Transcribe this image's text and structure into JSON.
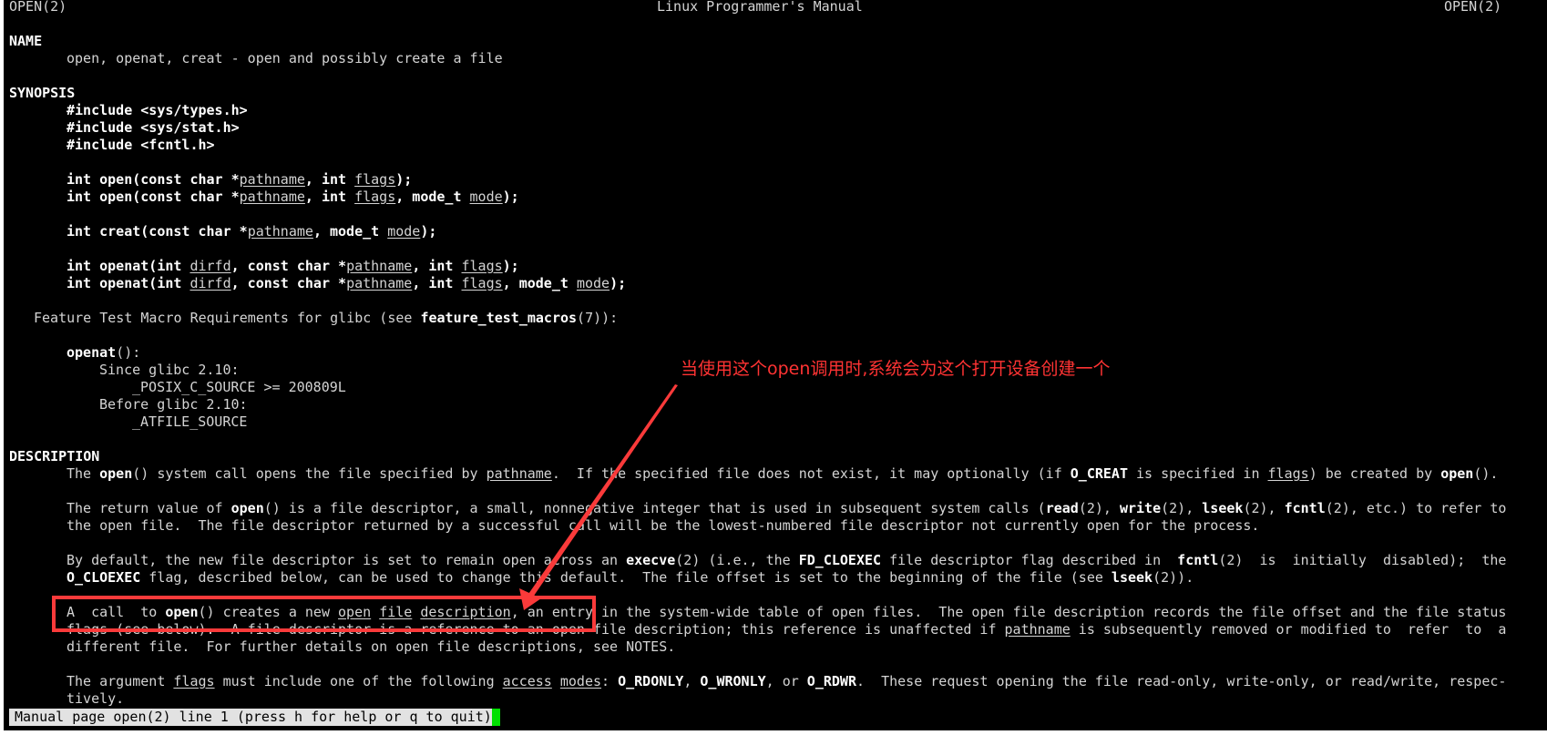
{
  "header": {
    "left": "OPEN(2)",
    "center": "Linux Programmer's Manual",
    "right": "OPEN(2)"
  },
  "lines": [
    {
      "row": 2,
      "col": 0,
      "seg": [
        [
          "b",
          "NAME"
        ]
      ]
    },
    {
      "row": 3,
      "col": 7,
      "seg": [
        [
          "n",
          "open, openat, creat - open and possibly create a file"
        ]
      ]
    },
    {
      "row": 5,
      "col": 0,
      "seg": [
        [
          "b",
          "SYNOPSIS"
        ]
      ]
    },
    {
      "row": 6,
      "col": 7,
      "seg": [
        [
          "b",
          "#include <sys/types.h>"
        ]
      ]
    },
    {
      "row": 7,
      "col": 7,
      "seg": [
        [
          "b",
          "#include <sys/stat.h>"
        ]
      ]
    },
    {
      "row": 8,
      "col": 7,
      "seg": [
        [
          "b",
          "#include <fcntl.h>"
        ]
      ]
    },
    {
      "row": 10,
      "col": 7,
      "seg": [
        [
          "b",
          "int open(const char *"
        ],
        [
          "u",
          "pathname"
        ],
        [
          "b",
          ", int "
        ],
        [
          "u",
          "flags"
        ],
        [
          "b",
          ");"
        ]
      ]
    },
    {
      "row": 11,
      "col": 7,
      "seg": [
        [
          "b",
          "int open(const char *"
        ],
        [
          "u",
          "pathname"
        ],
        [
          "b",
          ", int "
        ],
        [
          "u",
          "flags"
        ],
        [
          "b",
          ", mode_t "
        ],
        [
          "u",
          "mode"
        ],
        [
          "b",
          ");"
        ]
      ]
    },
    {
      "row": 13,
      "col": 7,
      "seg": [
        [
          "b",
          "int creat(const char *"
        ],
        [
          "u",
          "pathname"
        ],
        [
          "b",
          ", mode_t "
        ],
        [
          "u",
          "mode"
        ],
        [
          "b",
          ");"
        ]
      ]
    },
    {
      "row": 15,
      "col": 7,
      "seg": [
        [
          "b",
          "int openat(int "
        ],
        [
          "u",
          "dirfd"
        ],
        [
          "b",
          ", const char *"
        ],
        [
          "u",
          "pathname"
        ],
        [
          "b",
          ", int "
        ],
        [
          "u",
          "flags"
        ],
        [
          "b",
          ");"
        ]
      ]
    },
    {
      "row": 16,
      "col": 7,
      "seg": [
        [
          "b",
          "int openat(int "
        ],
        [
          "u",
          "dirfd"
        ],
        [
          "b",
          ", const char *"
        ],
        [
          "u",
          "pathname"
        ],
        [
          "b",
          ", int "
        ],
        [
          "u",
          "flags"
        ],
        [
          "b",
          ", mode_t "
        ],
        [
          "u",
          "mode"
        ],
        [
          "b",
          ");"
        ]
      ]
    },
    {
      "row": 18,
      "col": 3,
      "seg": [
        [
          "n",
          "Feature Test Macro Requirements for glibc (see "
        ],
        [
          "b",
          "feature_test_macros"
        ],
        [
          "n",
          "(7)):"
        ]
      ]
    },
    {
      "row": 20,
      "col": 7,
      "seg": [
        [
          "b",
          "openat"
        ],
        [
          "n",
          "():"
        ]
      ]
    },
    {
      "row": 21,
      "col": 11,
      "seg": [
        [
          "n",
          "Since glibc 2.10:"
        ]
      ]
    },
    {
      "row": 22,
      "col": 15,
      "seg": [
        [
          "n",
          "_POSIX_C_SOURCE >= 200809L"
        ]
      ]
    },
    {
      "row": 23,
      "col": 11,
      "seg": [
        [
          "n",
          "Before glibc 2.10:"
        ]
      ]
    },
    {
      "row": 24,
      "col": 15,
      "seg": [
        [
          "n",
          "_ATFILE_SOURCE"
        ]
      ]
    },
    {
      "row": 26,
      "col": 0,
      "seg": [
        [
          "b",
          "DESCRIPTION"
        ]
      ]
    },
    {
      "row": 27,
      "col": 7,
      "seg": [
        [
          "n",
          "The "
        ],
        [
          "b",
          "open"
        ],
        [
          "n",
          "() system call opens the file specified by "
        ],
        [
          "u",
          "pathname"
        ],
        [
          "n",
          ".  If the specified file does not exist, it may optionally (if "
        ],
        [
          "b",
          "O_CREAT"
        ],
        [
          "n",
          " is specified in "
        ],
        [
          "u",
          "flags"
        ],
        [
          "n",
          ") be created by "
        ],
        [
          "b",
          "open"
        ],
        [
          "n",
          "()."
        ]
      ]
    },
    {
      "row": 29,
      "col": 7,
      "seg": [
        [
          "n",
          "The return value of "
        ],
        [
          "b",
          "open"
        ],
        [
          "n",
          "() is a file descriptor, a small, nonnegative integer that is used in subsequent system calls ("
        ],
        [
          "b",
          "read"
        ],
        [
          "n",
          "(2), "
        ],
        [
          "b",
          "write"
        ],
        [
          "n",
          "(2), "
        ],
        [
          "b",
          "lseek"
        ],
        [
          "n",
          "(2), "
        ],
        [
          "b",
          "fcntl"
        ],
        [
          "n",
          "(2), etc.) to refer to"
        ]
      ]
    },
    {
      "row": 30,
      "col": 7,
      "seg": [
        [
          "n",
          "the open file.  The file descriptor returned by a successful call will be the lowest-numbered file descriptor not currently open for the process."
        ]
      ]
    },
    {
      "row": 32,
      "col": 7,
      "seg": [
        [
          "n",
          "By default, the new file descriptor is set to remain open across an "
        ],
        [
          "b",
          "execve"
        ],
        [
          "n",
          "(2) (i.e., the "
        ],
        [
          "b",
          "FD_CLOEXEC"
        ],
        [
          "n",
          " file descriptor flag described in  "
        ],
        [
          "b",
          "fcntl"
        ],
        [
          "n",
          "(2)  is  initially  disabled);  the"
        ]
      ]
    },
    {
      "row": 33,
      "col": 7,
      "seg": [
        [
          "b",
          "O_CLOEXEC"
        ],
        [
          "n",
          " flag, described below, can be used to change this default.  The file offset is set to the beginning of the file (see "
        ],
        [
          "b",
          "lseek"
        ],
        [
          "n",
          "(2))."
        ]
      ]
    },
    {
      "row": 35,
      "col": 7,
      "seg": [
        [
          "n",
          "A  call  to "
        ],
        [
          "b",
          "open"
        ],
        [
          "n",
          "() creates a new "
        ],
        [
          "u",
          "open"
        ],
        [
          "n",
          " "
        ],
        [
          "u",
          "file"
        ],
        [
          "n",
          " "
        ],
        [
          "u",
          "description"
        ],
        [
          "n",
          ", an entry in the system-wide table of open files.  The open file description records the file offset and the file status"
        ]
      ]
    },
    {
      "row": 36,
      "col": 7,
      "seg": [
        [
          "n",
          "flags (see below).  A file descriptor is a reference to an open file description; this reference is unaffected if "
        ],
        [
          "u",
          "pathname"
        ],
        [
          "n",
          " is subsequently removed or modified to  refer  to  a"
        ]
      ]
    },
    {
      "row": 37,
      "col": 7,
      "seg": [
        [
          "n",
          "different file.  For further details on open file descriptions, see NOTES."
        ]
      ]
    },
    {
      "row": 39,
      "col": 7,
      "seg": [
        [
          "n",
          "The argument "
        ],
        [
          "u",
          "flags"
        ],
        [
          "n",
          " must include one of the following "
        ],
        [
          "u",
          "access"
        ],
        [
          "n",
          " "
        ],
        [
          "u",
          "modes"
        ],
        [
          "n",
          ": "
        ],
        [
          "b",
          "O_RDONLY"
        ],
        [
          "n",
          ", "
        ],
        [
          "b",
          "O_WRONLY"
        ],
        [
          "n",
          ", or "
        ],
        [
          "b",
          "O_RDWR"
        ],
        [
          "n",
          ".  These request opening the file read-only, write-only, or read/write, respec-"
        ]
      ]
    },
    {
      "row": 40,
      "col": 7,
      "seg": [
        [
          "n",
          "tively."
        ]
      ]
    }
  ],
  "status": "Manual page open(2) line 1 (press h for help or q to quit)",
  "annotation": {
    "text": "当使用这个open调用时,系统会为这个打开设备创建一个",
    "color": "#ff3333"
  },
  "colors": {
    "background": "#000000",
    "cursor": "#00e000",
    "highlight_box": "#fa3a3a"
  }
}
